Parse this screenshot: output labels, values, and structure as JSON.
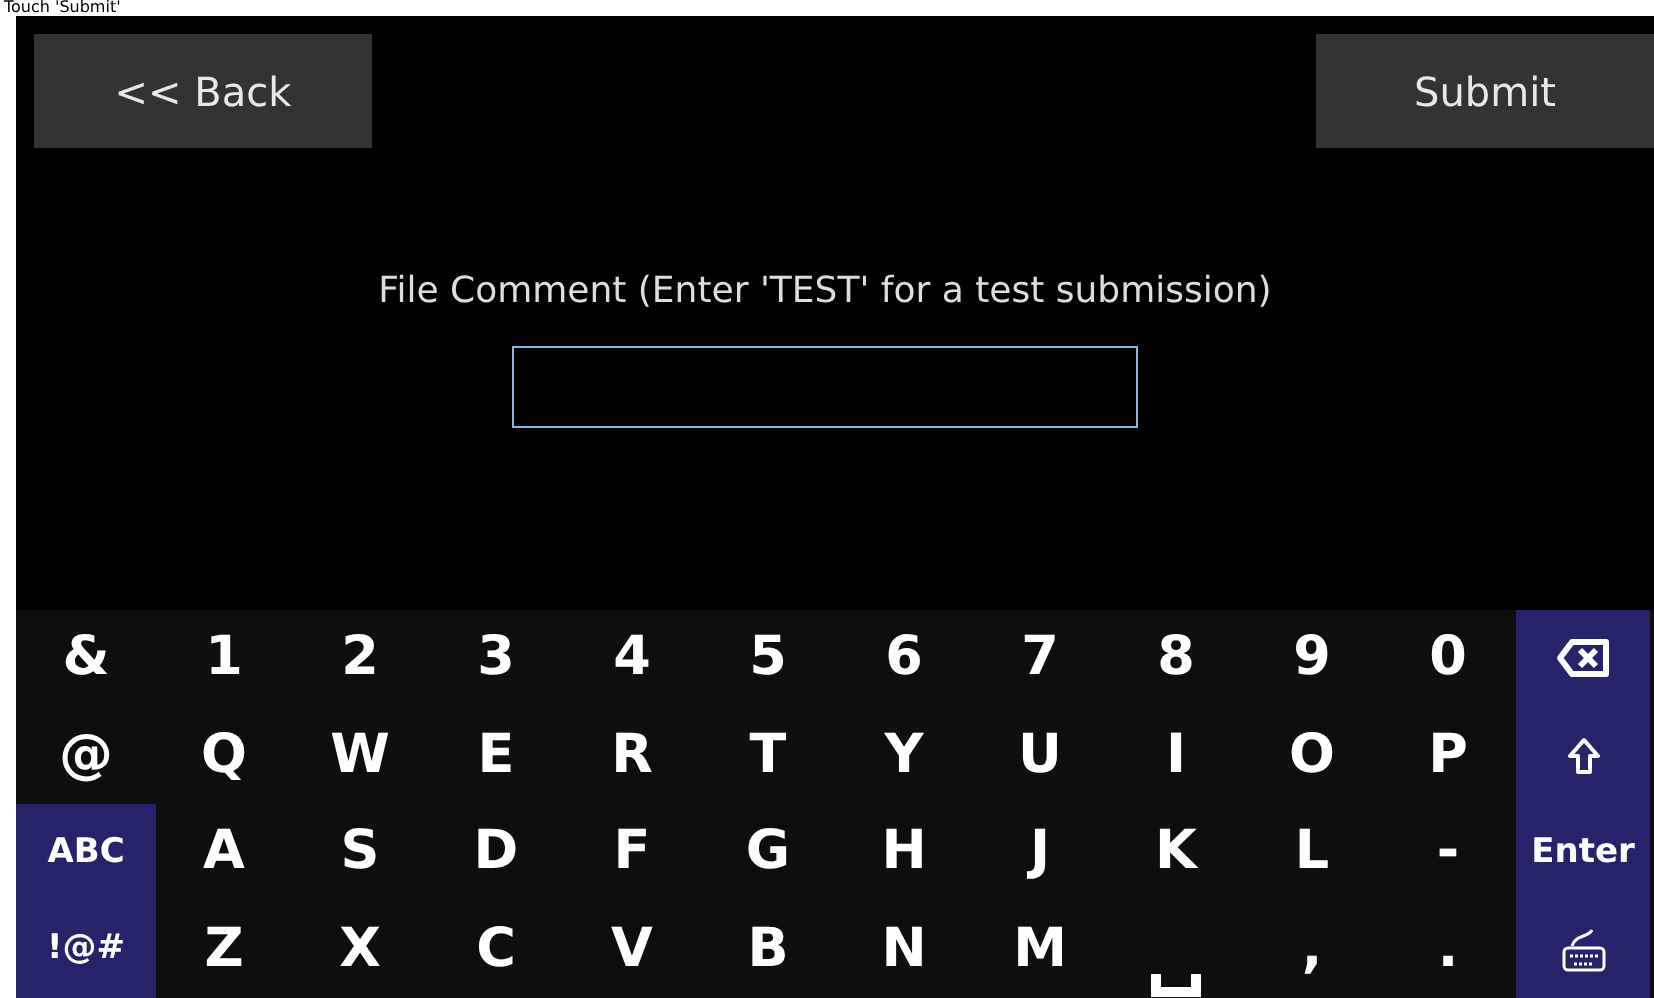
{
  "instruction": "Touch 'Submit'",
  "back_button": "<< Back",
  "submit_button": "Submit",
  "comment_label": "File Comment (Enter 'TEST' for a test submission)",
  "keyboard": {
    "rows": [
      [
        {
          "kind": "char",
          "label": "&"
        },
        {
          "kind": "char",
          "label": "1"
        },
        {
          "kind": "char",
          "label": "2"
        },
        {
          "kind": "char",
          "label": "3"
        },
        {
          "kind": "char",
          "label": "4"
        },
        {
          "kind": "char",
          "label": "5"
        },
        {
          "kind": "char",
          "label": "6"
        },
        {
          "kind": "char",
          "label": "7"
        },
        {
          "kind": "char",
          "label": "8"
        },
        {
          "kind": "char",
          "label": "9"
        },
        {
          "kind": "char",
          "label": "0"
        },
        {
          "kind": "backspace"
        }
      ],
      [
        {
          "kind": "char",
          "label": "@"
        },
        {
          "kind": "char",
          "label": "Q"
        },
        {
          "kind": "char",
          "label": "W"
        },
        {
          "kind": "char",
          "label": "E"
        },
        {
          "kind": "char",
          "label": "R"
        },
        {
          "kind": "char",
          "label": "T"
        },
        {
          "kind": "char",
          "label": "Y"
        },
        {
          "kind": "char",
          "label": "U"
        },
        {
          "kind": "char",
          "label": "I"
        },
        {
          "kind": "char",
          "label": "O"
        },
        {
          "kind": "char",
          "label": "P"
        },
        {
          "kind": "shift"
        }
      ],
      [
        {
          "kind": "mode",
          "label": "ABC"
        },
        {
          "kind": "char",
          "label": "A"
        },
        {
          "kind": "char",
          "label": "S"
        },
        {
          "kind": "char",
          "label": "D"
        },
        {
          "kind": "char",
          "label": "F"
        },
        {
          "kind": "char",
          "label": "G"
        },
        {
          "kind": "char",
          "label": "H"
        },
        {
          "kind": "char",
          "label": "J"
        },
        {
          "kind": "char",
          "label": "K"
        },
        {
          "kind": "char",
          "label": "L"
        },
        {
          "kind": "char",
          "label": "-"
        },
        {
          "kind": "mode",
          "label": "Enter"
        }
      ],
      [
        {
          "kind": "mode",
          "label": "!@#"
        },
        {
          "kind": "char",
          "label": "Z"
        },
        {
          "kind": "char",
          "label": "X"
        },
        {
          "kind": "char",
          "label": "C"
        },
        {
          "kind": "char",
          "label": "V"
        },
        {
          "kind": "char",
          "label": "B"
        },
        {
          "kind": "char",
          "label": "N"
        },
        {
          "kind": "char",
          "label": "M"
        },
        {
          "kind": "space"
        },
        {
          "kind": "char",
          "label": ","
        },
        {
          "kind": "char",
          "label": "."
        },
        {
          "kind": "hide"
        }
      ]
    ]
  }
}
